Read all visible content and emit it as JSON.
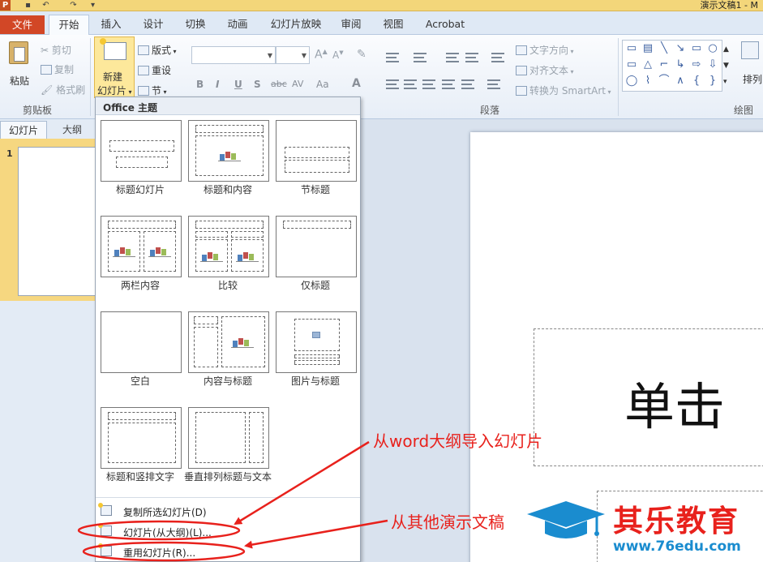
{
  "titlebar": {
    "window_title": "演示文稿1 - M",
    "app_icon": "P",
    "icons": [
      "powerpoint-app-icon",
      "save-icon",
      "undo-icon",
      "redo-icon",
      "customize-quick-access-icon"
    ]
  },
  "tabs": [
    {
      "label": "文件",
      "active": false
    },
    {
      "label": "开始",
      "active": true
    },
    {
      "label": "插入",
      "active": false
    },
    {
      "label": "设计",
      "active": false
    },
    {
      "label": "切换",
      "active": false
    },
    {
      "label": "动画",
      "active": false
    },
    {
      "label": "幻灯片放映",
      "active": false
    },
    {
      "label": "审阅",
      "active": false
    },
    {
      "label": "视图",
      "active": false
    },
    {
      "label": "Acrobat",
      "active": false
    }
  ],
  "ribbon": {
    "clipboard": {
      "paste": "粘贴",
      "cut": "剪切",
      "copy": "复制",
      "format_painter": "格式刷",
      "group_label": "剪贴板"
    },
    "slides": {
      "new_slide_line1": "新建",
      "new_slide_line2": "幻灯片",
      "layout": "版式",
      "reset": "重设",
      "section": "节"
    },
    "font": {
      "bold": "B",
      "italic": "I",
      "underline": "U",
      "shadow": "S",
      "strikethrough": "abc",
      "spacing": "AV",
      "change_case": "Aa",
      "font_color": "A",
      "grow": "A",
      "shrink": "A"
    },
    "paragraph": {
      "text_direction": "文字方向",
      "align_text": "对齐文本",
      "smartart": "转换为 SmartArt",
      "group_label": "段落"
    },
    "drawing": {
      "arrange": "排列",
      "group_label": "绘图",
      "shapes": [
        "▭",
        "▤",
        "╲",
        "↘",
        "▭",
        "○",
        "▭",
        "△",
        "⌐",
        "↳",
        "⇨",
        "⇩",
        "◯",
        "⌇",
        "⌒",
        "∧",
        "{",
        "}"
      ]
    }
  },
  "left_pane": {
    "tab_slides": "幻灯片",
    "tab_outline": "大纲",
    "slide_number": "1"
  },
  "slide": {
    "title_text": "单击"
  },
  "dropdown": {
    "header": "Office 主题",
    "layouts": [
      {
        "label": "标题幻灯片"
      },
      {
        "label": "标题和内容"
      },
      {
        "label": "节标题"
      },
      {
        "label": "两栏内容"
      },
      {
        "label": "比较"
      },
      {
        "label": "仅标题"
      },
      {
        "label": "空白"
      },
      {
        "label": "内容与标题"
      },
      {
        "label": "图片与标题"
      },
      {
        "label": "标题和竖排文字"
      },
      {
        "label": "垂直排列标题与文本"
      }
    ],
    "commands": [
      {
        "label": "复制所选幻灯片(D)"
      },
      {
        "label": "幻灯片(从大纲)(L)..."
      },
      {
        "label": "重用幻灯片(R)..."
      }
    ]
  },
  "annotations": {
    "outline_import": "从word大纲导入幻灯片",
    "other_presentation": "从其他演示文稿",
    "color": "#e8211c"
  },
  "watermark": {
    "title": "其乐教育",
    "url": "www.76edu.com"
  },
  "colors": {
    "file_tab": "#d24726",
    "ribbon_bg": "#e7eef7",
    "selected_slide": "#f6d780",
    "annotation_red": "#e8211c",
    "watermark_blue": "#1a8ccf"
  }
}
